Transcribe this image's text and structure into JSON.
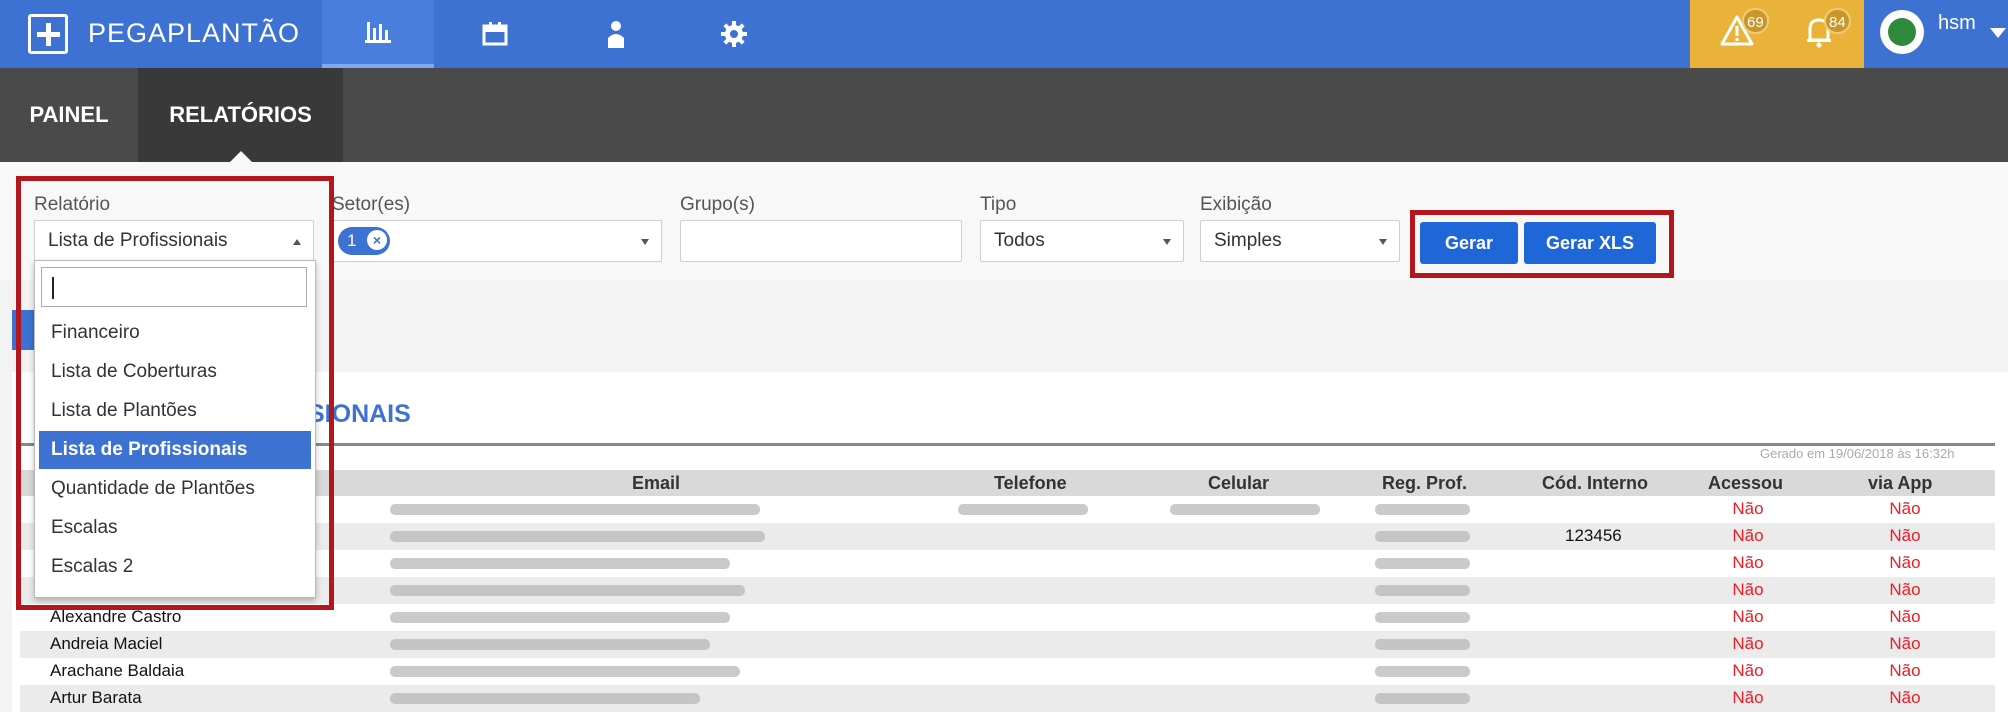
{
  "app": {
    "brand": "PEGAPLANTÃO"
  },
  "topnav": {
    "icons": [
      "bar-chart-icon",
      "calendar-icon",
      "user-icon",
      "gear-icon"
    ]
  },
  "alerts": {
    "warnings_count": "69",
    "notifications_count": "84",
    "color": "#e9b33a"
  },
  "user": {
    "name": "hsm"
  },
  "subnav": {
    "tabs": [
      "PAINEL",
      "RELATÓRIOS"
    ],
    "active": "RELATÓRIOS"
  },
  "filters": {
    "relatorio_label": "Relatório",
    "relatorio_value": "Lista de Profissionais",
    "setor_label": "Setor(es)",
    "setor_chip": "1",
    "grupo_label": "Grupo(s)",
    "grupo_value": "",
    "tipo_label": "Tipo",
    "tipo_value": "Todos",
    "exibicao_label": "Exibição",
    "exibicao_value": "Simples",
    "gerar_label": "Gerar",
    "gerar_xls_label": "Gerar XLS"
  },
  "dropdown": {
    "search_value": "",
    "options": [
      "Financeiro",
      "Lista de Coberturas",
      "Lista de Plantões",
      "Lista de Profissionais",
      "Quantidade de Plantões",
      "Escalas",
      "Escalas 2"
    ],
    "selected": "Lista de Profissionais"
  },
  "report": {
    "title_visible": "SIONAIS",
    "generated": "Gerado em 19/06/2018 às 16:32h",
    "columns": [
      "Email",
      "Telefone",
      "Celular",
      "Reg. Prof.",
      "Cód. Interno",
      "Acessou",
      "via App"
    ],
    "rows": [
      {
        "name": "",
        "cod": "",
        "acessou": "Não",
        "via_app": "Não"
      },
      {
        "name": "",
        "cod": "123456",
        "acessou": "Não",
        "via_app": "Não"
      },
      {
        "name": "",
        "cod": "",
        "acessou": "Não",
        "via_app": "Não"
      },
      {
        "name": "",
        "cod": "",
        "acessou": "Não",
        "via_app": "Não"
      },
      {
        "name": "Alexandre Castro",
        "cod": "",
        "acessou": "Não",
        "via_app": "Não"
      },
      {
        "name": "Andreia Maciel",
        "cod": "",
        "acessou": "Não",
        "via_app": "Não"
      },
      {
        "name": "Arachane Baldaia",
        "cod": "",
        "acessou": "Não",
        "via_app": "Não"
      },
      {
        "name": "Artur Barata",
        "cod": "",
        "acessou": "Não",
        "via_app": "Não"
      }
    ]
  },
  "colors": {
    "primary": "#3d72d3",
    "highlight": "#b3161c",
    "negative": "#ee1c24"
  }
}
